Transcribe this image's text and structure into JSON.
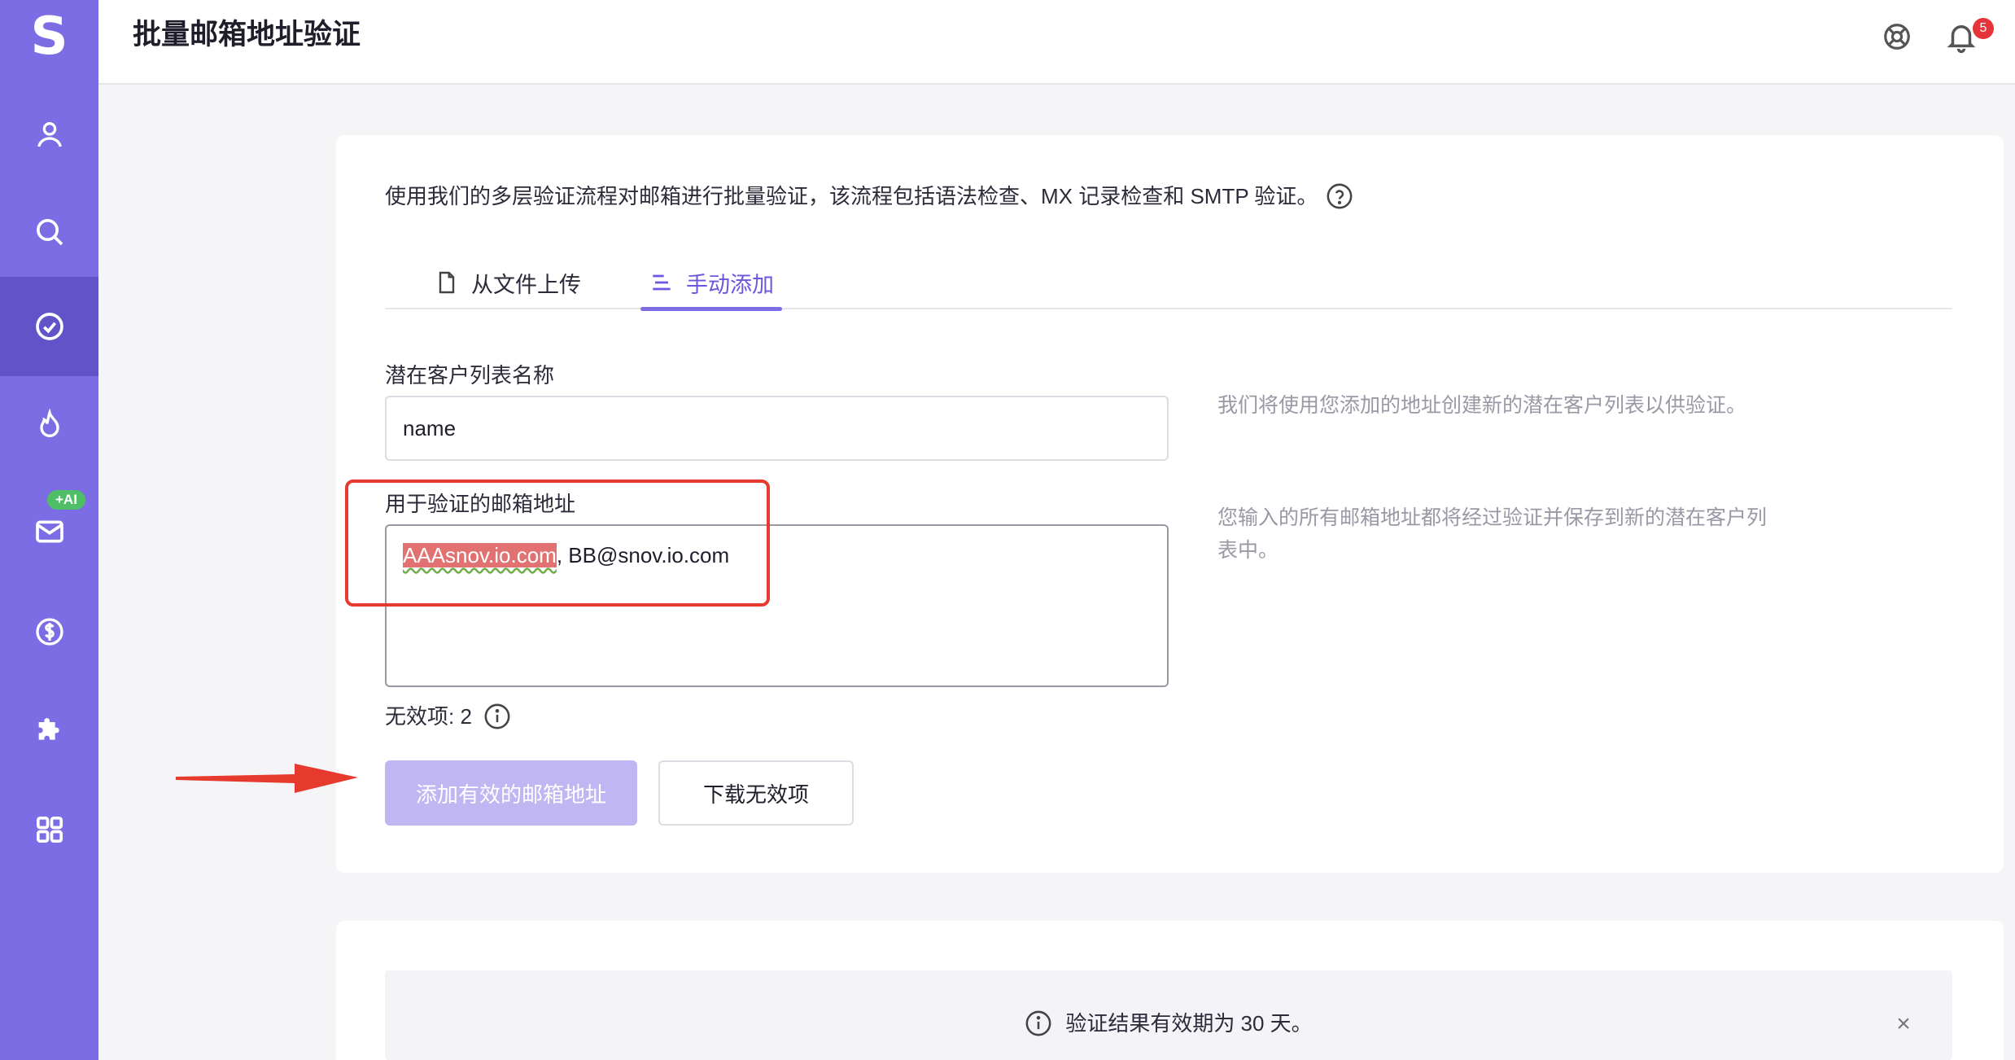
{
  "sidebar": {
    "logo": "S",
    "ai_badge": "+AI",
    "items": [
      {
        "icon": "user-icon"
      },
      {
        "icon": "search-icon"
      },
      {
        "icon": "check-circle-icon",
        "active": true
      },
      {
        "icon": "flame-icon"
      },
      {
        "icon": "mail-icon"
      },
      {
        "icon": "dollar-icon"
      },
      {
        "icon": "puzzle-icon"
      },
      {
        "icon": "apps-grid-icon"
      }
    ]
  },
  "header": {
    "title": "批量邮箱地址验证",
    "notifications": "5"
  },
  "main": {
    "description": "使用我们的多层验证流程对邮箱进行批量验证，该流程包括语法检查、MX 记录检查和 SMTP 验证。",
    "tabs": [
      {
        "label": "从文件上传"
      },
      {
        "label": "手动添加",
        "active": true
      }
    ],
    "list_name_label": "潜在客户列表名称",
    "list_name_value": "name",
    "list_name_hint": "我们将使用您添加的地址创建新的潜在客户列表以供验证。",
    "emails_label": "用于验证的邮箱地址",
    "emails_invalid_token": "AAAsnov.io.com",
    "emails_rest": ", BB@snov.io.com",
    "emails_hint_line1": "您输入的所有邮箱地址都将经过验证并保存到新的潜在客户列",
    "emails_hint_line2": "表中。",
    "invalid_count_label": "无效项: 2",
    "add_valid_button": "添加有效的邮箱地址",
    "download_invalid_button": "下载无效项"
  },
  "notice": {
    "message": "验证结果有效期为 30 天。",
    "close": "×"
  },
  "colors": {
    "sidebar": "#7d6de4",
    "sidebar_active": "#6353c9",
    "accent": "#6b57df",
    "annotation_red": "#e63a2f"
  }
}
